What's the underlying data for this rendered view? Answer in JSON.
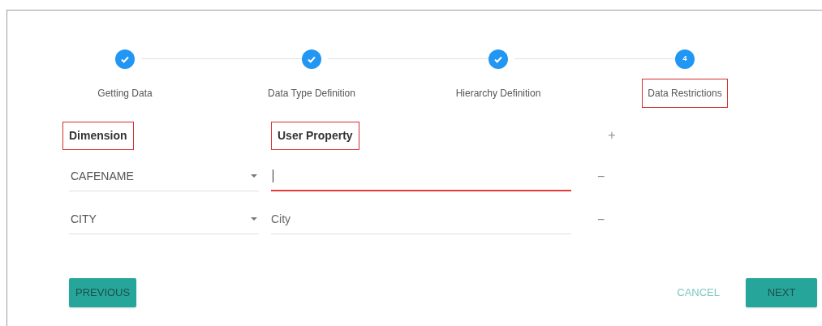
{
  "steps": [
    {
      "label": "Getting Data",
      "completed": true,
      "highlighted": false
    },
    {
      "label": "Data Type Definition",
      "completed": true,
      "highlighted": false
    },
    {
      "label": "Hierarchy Definition",
      "completed": true,
      "highlighted": false
    },
    {
      "label": "Data Restrictions",
      "completed": false,
      "number": "4",
      "highlighted": true
    }
  ],
  "columns": [
    {
      "label": "Dimension",
      "highlighted": true
    },
    {
      "label": "User Property",
      "highlighted": true
    }
  ],
  "add_button": "+",
  "rows": [
    {
      "dimension": "CAFENAME",
      "user_property": "",
      "invalid": true,
      "remove": "−"
    },
    {
      "dimension": "CITY",
      "user_property": "City",
      "invalid": false,
      "remove": "−"
    }
  ],
  "buttons": {
    "previous": "PREVIOUS",
    "cancel": "CANCEL",
    "next": "NEXT"
  }
}
